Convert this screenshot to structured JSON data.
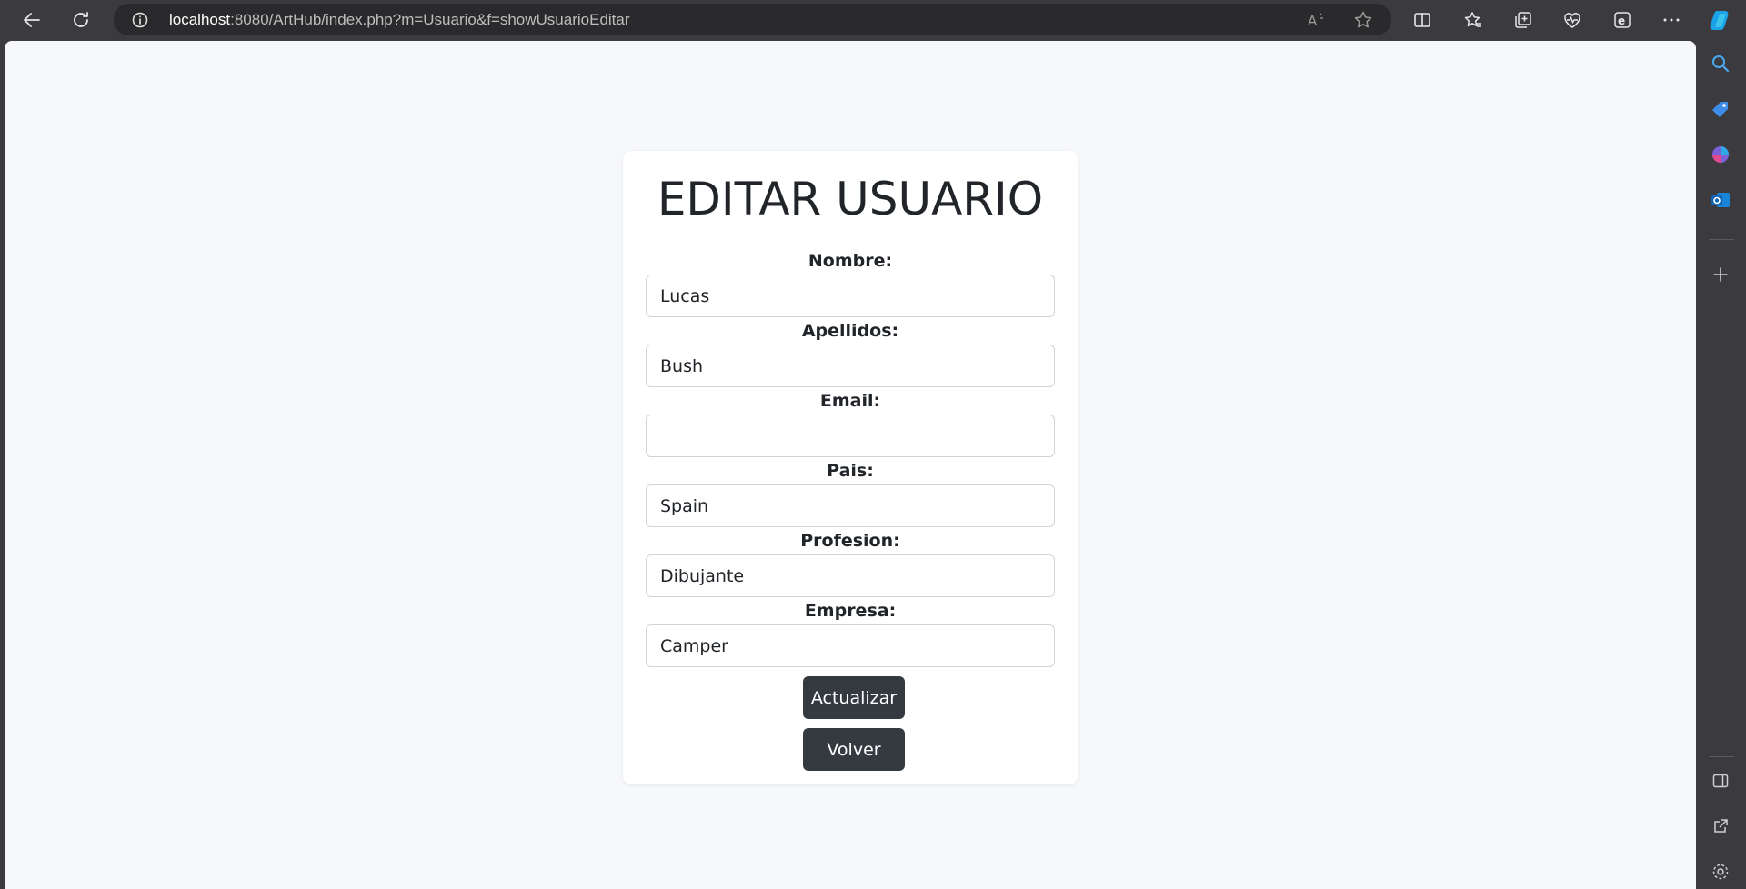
{
  "browser": {
    "url_host": "localhost",
    "url_rest": ":8080/ArtHub/index.php?m=Usuario&f=showUsuarioEditar",
    "icons": {
      "back": "back-arrow-icon",
      "refresh": "refresh-icon",
      "info": "info-icon",
      "read_aloud": "read-aloud-icon",
      "favorite": "star-icon",
      "split": "split-screen-icon",
      "favorites": "favorites-icon",
      "collections": "collections-icon",
      "health": "browser-essentials-icon",
      "edge": "edge-icon",
      "more": "more-icon",
      "copilot": "copilot-icon"
    }
  },
  "sidebar": {
    "icons": [
      "search-icon",
      "shopping-tag-icon",
      "games-icon",
      "outlook-icon",
      "add-icon",
      "sidebar-toggle-icon",
      "external-link-icon",
      "settings-icon"
    ]
  },
  "form": {
    "title": "EDITAR USUARIO",
    "fields": [
      {
        "label": "Nombre:",
        "value": "Lucas"
      },
      {
        "label": "Apellidos:",
        "value": "Bush"
      },
      {
        "label": "Email:",
        "value": ""
      },
      {
        "label": "Pais:",
        "value": "Spain"
      },
      {
        "label": "Profesion:",
        "value": "Dibujante"
      },
      {
        "label": "Empresa:",
        "value": "Camper"
      }
    ],
    "submit_label": "Actualizar",
    "back_label": "Volver"
  },
  "colors": {
    "chrome": "#3b3b3f",
    "page_bg": "#f7f8fa",
    "button": "#343a40",
    "text": "#212529"
  }
}
